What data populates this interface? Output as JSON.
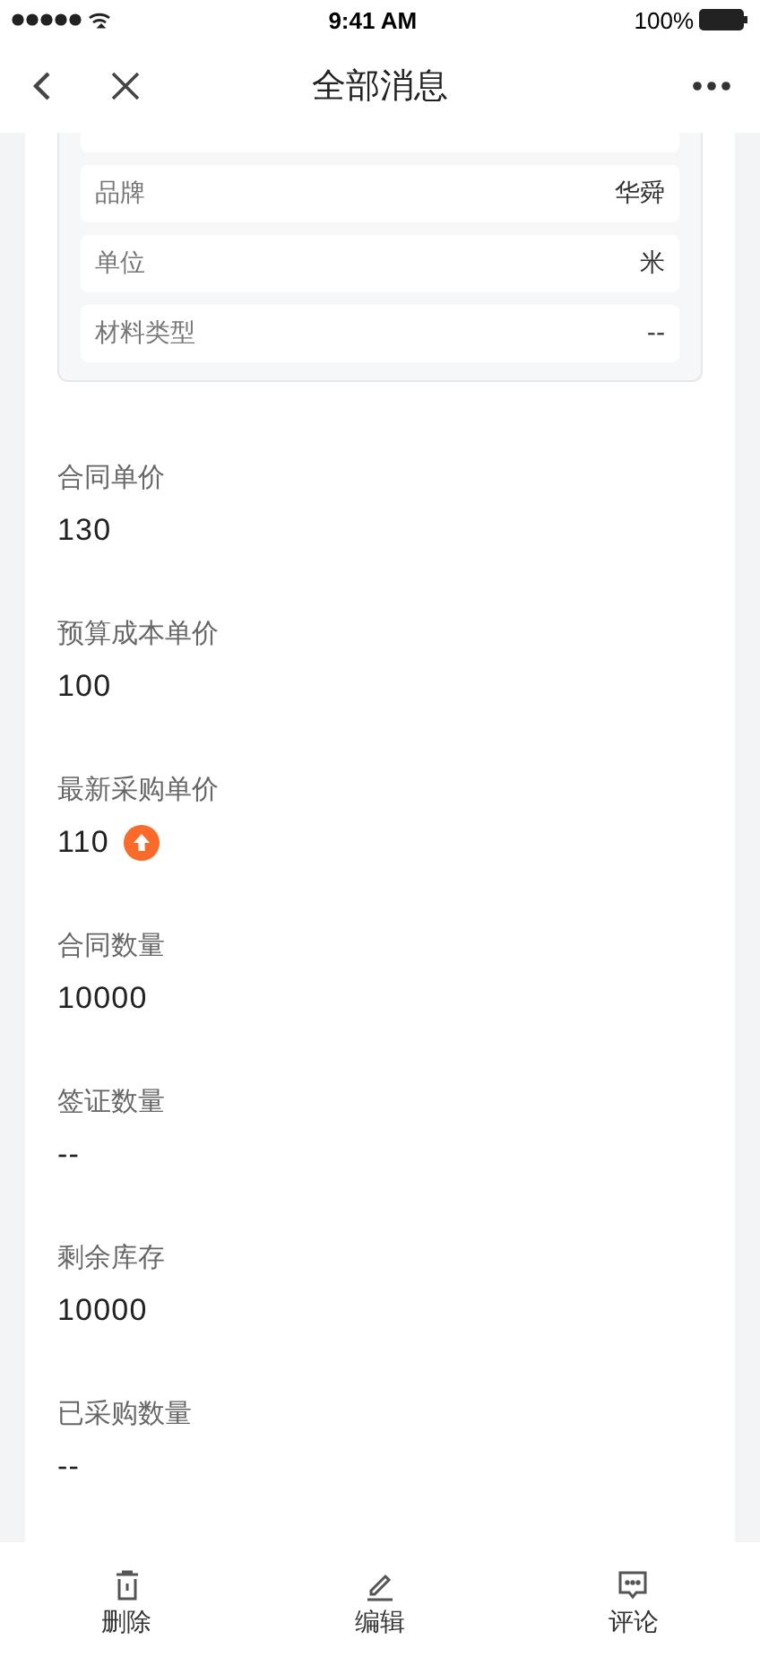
{
  "status_bar": {
    "time": "9:41 AM",
    "battery": "100%"
  },
  "nav": {
    "title": "全部消息"
  },
  "spec_rows": [
    {
      "label": "品牌",
      "value": "华舜"
    },
    {
      "label": "单位",
      "value": "米"
    },
    {
      "label": "材料类型",
      "value": "--"
    }
  ],
  "fields": [
    {
      "label": "合同单价",
      "value": "130",
      "rising": false
    },
    {
      "label": "预算成本单价",
      "value": "100",
      "rising": false
    },
    {
      "label": "最新采购单价",
      "value": "110",
      "rising": true
    },
    {
      "label": "合同数量",
      "value": "10000",
      "rising": false
    },
    {
      "label": "签证数量",
      "value": "--",
      "rising": false
    },
    {
      "label": "剩余库存",
      "value": "10000",
      "rising": false
    },
    {
      "label": "已采购数量",
      "value": "--",
      "rising": false
    }
  ],
  "actions": [
    {
      "kind": "delete",
      "label": "删除"
    },
    {
      "kind": "edit",
      "label": "编辑"
    },
    {
      "kind": "comment",
      "label": "评论"
    }
  ]
}
